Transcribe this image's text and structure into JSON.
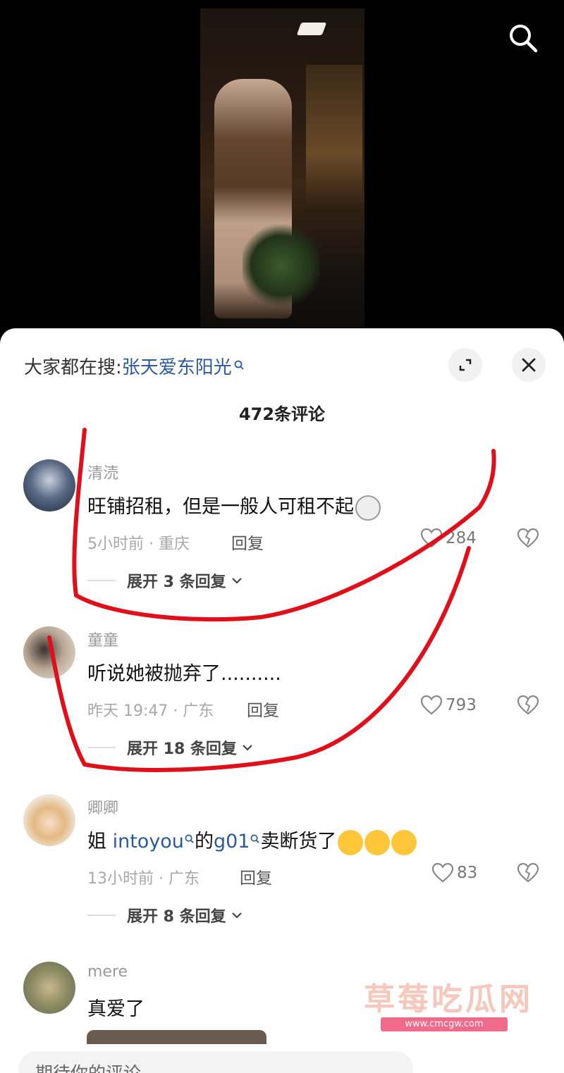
{
  "video": {
    "search_icon": "search-icon"
  },
  "panel": {
    "suggest_label": "大家都在搜:",
    "suggest_keyword": "张天爱东阳光",
    "expand_icon": "expand-icon",
    "close_icon": "close-icon",
    "comment_count": "472条评论"
  },
  "comments": [
    {
      "name": "清涜",
      "text": "旺铺招租，但是一般人可租不起",
      "meta": "5小时前 · 重庆",
      "reply": "回复",
      "likes": "284",
      "expand": "展开 3 条回复"
    },
    {
      "name": "童童",
      "text": "听说她被抛弃了..........",
      "meta": "昨天 19:47 · 广东",
      "reply": "回复",
      "likes": "793",
      "expand": "展开 18 条回复"
    },
    {
      "name": "卿卿",
      "text_prefix": "姐 ",
      "link1": "intoyou",
      "text_mid": "的",
      "link2": "g01",
      "text_suffix": "卖断货了",
      "meta": "13小时前 · 广东",
      "reply": "回复",
      "likes": "83",
      "expand": "展开 8 条回复"
    },
    {
      "name": "mere",
      "text": "真爱了"
    }
  ],
  "input": {
    "placeholder": "期待你的评论"
  },
  "watermark": {
    "title": "草莓吃瓜网",
    "url": "www.cmcgw.com"
  },
  "colors": {
    "link": "#2a5b9e",
    "annotation": "#e0101a"
  }
}
